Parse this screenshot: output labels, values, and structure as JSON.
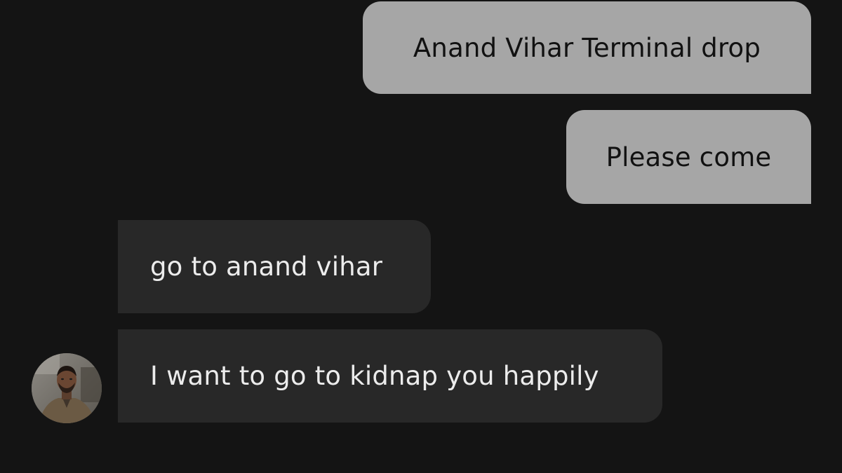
{
  "conversation": {
    "messages": [
      {
        "direction": "outgoing",
        "text": "Anand Vihar Terminal drop"
      },
      {
        "direction": "outgoing",
        "text": "Please come"
      },
      {
        "direction": "incoming",
        "text": "go to anand vihar"
      },
      {
        "direction": "incoming",
        "text": "I want to go to kidnap you happily"
      }
    ]
  },
  "colors": {
    "background": "#141414",
    "outgoing_bubble": "#a6a6a6",
    "outgoing_text": "#111111",
    "incoming_bubble": "#282828",
    "incoming_text": "#ececec"
  },
  "icons": {
    "avatar": "driver-avatar-photo"
  }
}
